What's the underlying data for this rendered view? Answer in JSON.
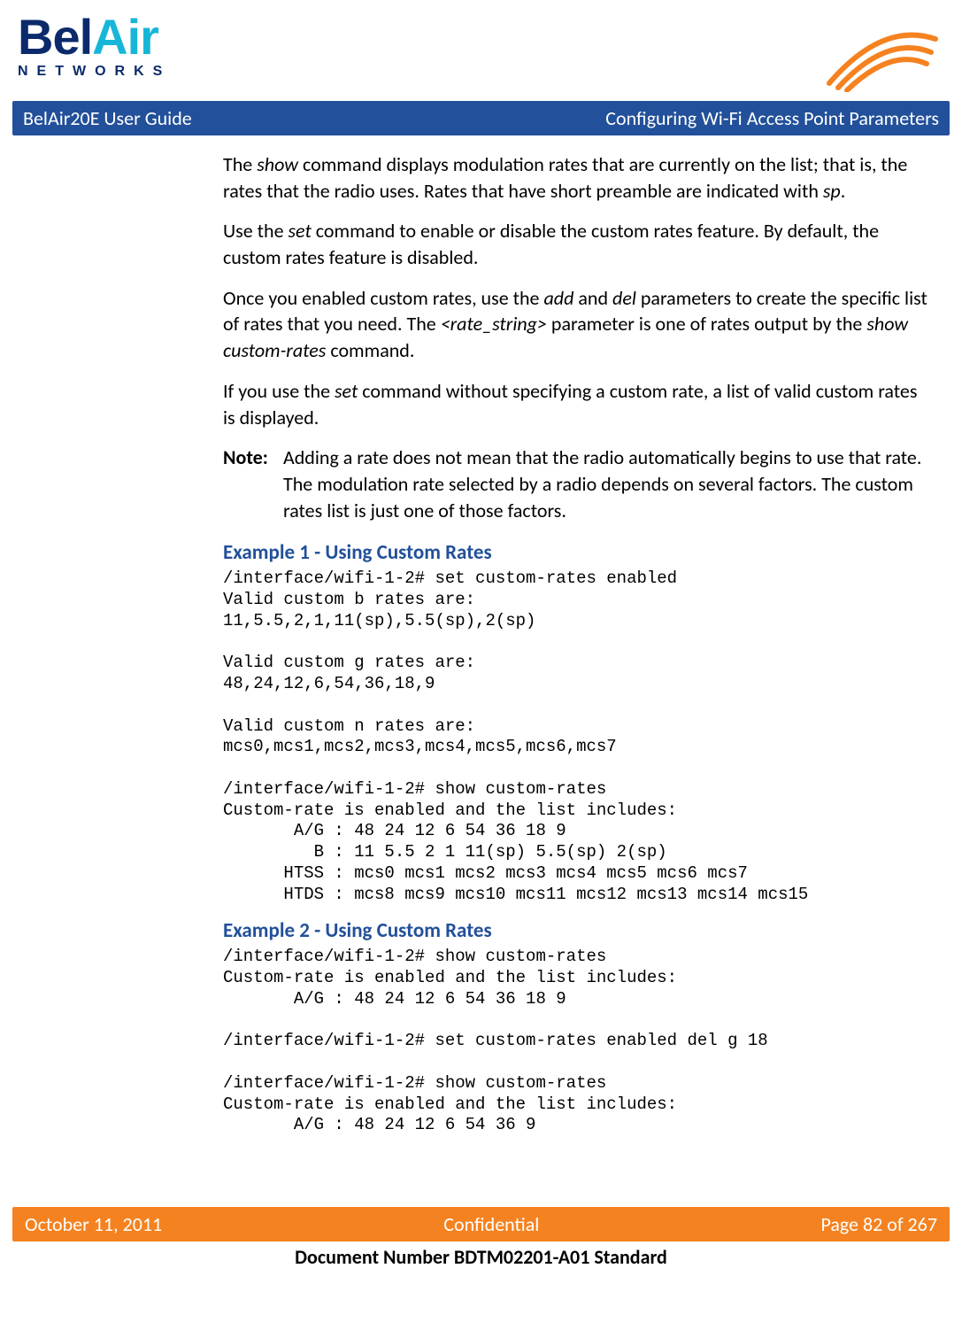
{
  "logo": {
    "part1": "Bel",
    "part2": "Air",
    "sub": "NETWORKS"
  },
  "titleBar": {
    "left": "BelAir20E User Guide",
    "right": "Configuring Wi-Fi Access Point Parameters"
  },
  "paragraphs": {
    "p1a": "The ",
    "p1b": "show",
    "p1c": " command displays modulation rates that are currently on the list; that is, the rates that the radio uses. Rates that have short preamble are indicated with ",
    "p1d": "sp",
    "p1e": ".",
    "p2a": "Use the ",
    "p2b": "set",
    "p2c": " command to enable or disable the custom rates feature. By default, the custom rates feature is disabled.",
    "p3a": "Once you enabled custom rates, use the ",
    "p3b": "add",
    "p3c": " and ",
    "p3d": "del",
    "p3e": " parameters to create the specific list of rates that you need. The ",
    "p3f": "<rate_string>",
    "p3g": " parameter is one of rates output by the ",
    "p3h": "show custom-rates",
    "p3i": " command.",
    "p4a": "If you use the ",
    "p4b": "set",
    "p4c": " command without specifying a custom rate, a list of valid custom rates is displayed."
  },
  "note": {
    "label": "Note:",
    "text": "Adding a rate does not mean that the radio automatically begins to use that rate. The modulation rate selected by a radio depends on several factors. The custom rates list is just one of those factors."
  },
  "example1": {
    "heading": "Example 1 - Using Custom Rates",
    "code": "/interface/wifi-1-2# set custom-rates enabled\nValid custom b rates are:\n11,5.5,2,1,11(sp),5.5(sp),2(sp)\n\nValid custom g rates are:\n48,24,12,6,54,36,18,9\n\nValid custom n rates are:\nmcs0,mcs1,mcs2,mcs3,mcs4,mcs5,mcs6,mcs7\n\n/interface/wifi-1-2# show custom-rates\nCustom-rate is enabled and the list includes:\n       A/G : 48 24 12 6 54 36 18 9\n         B : 11 5.5 2 1 11(sp) 5.5(sp) 2(sp)\n      HTSS : mcs0 mcs1 mcs2 mcs3 mcs4 mcs5 mcs6 mcs7\n      HTDS : mcs8 mcs9 mcs10 mcs11 mcs12 mcs13 mcs14 mcs15"
  },
  "example2": {
    "heading": "Example 2 - Using Custom Rates",
    "code": "/interface/wifi-1-2# show custom-rates\nCustom-rate is enabled and the list includes:\n       A/G : 48 24 12 6 54 36 18 9\n\n/interface/wifi-1-2# set custom-rates enabled del g 18\n\n/interface/wifi-1-2# show custom-rates\nCustom-rate is enabled and the list includes:\n       A/G : 48 24 12 6 54 36 9"
  },
  "footer": {
    "left": "October 11, 2011",
    "center": "Confidential",
    "right": "Page 82 of 267"
  },
  "docNumber": "Document Number BDTM02201-A01 Standard"
}
